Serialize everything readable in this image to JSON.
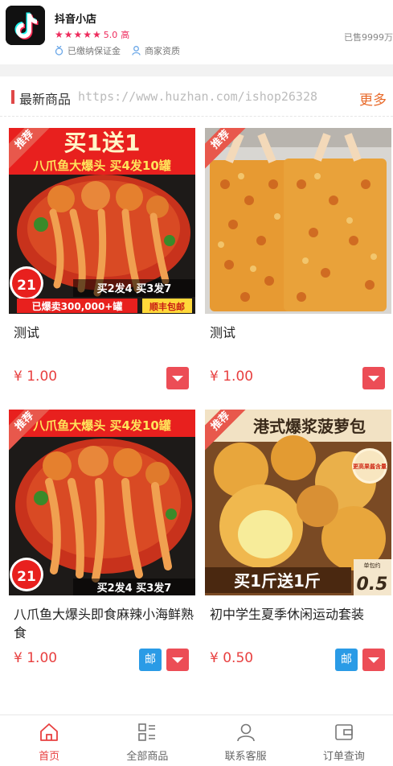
{
  "shop": {
    "name": "抖音小店",
    "stars": "★★★★★",
    "rating": "5.0",
    "rating_label": "高",
    "deposit": "已缴纳保证金",
    "qualification": "商家资质",
    "sold": "已售9999万"
  },
  "section": {
    "title": "最新商品",
    "watermark": "https://www.huzhan.com/ishop26328",
    "more": "更多"
  },
  "products": [
    {
      "tag": "推荐",
      "title": "测试",
      "price": "¥ 1.00",
      "image": "octopus-promo-image",
      "banner_top": "买1送1",
      "banner_mid": "八爪鱼大爆头 买4发10罐",
      "price_badge": "21",
      "promo_line": "买2发4 买3发7",
      "sold_line": "已爆卖300,000+罐",
      "ship": "顺丰包邮",
      "has_mail": false
    },
    {
      "tag": "推荐",
      "title": "测试",
      "price": "¥ 1.00",
      "image": "peanut-bags-image",
      "has_mail": false
    },
    {
      "tag": "推荐",
      "title": "八爪鱼大爆头即食麻辣小海鲜熟食",
      "price": "¥ 1.00",
      "image": "octopus-image",
      "banner_mid": "八爪鱼大爆头 买4发10罐",
      "price_badge": "21",
      "promo_line": "买2发4 买3发7",
      "has_mail": true,
      "mail_label": "邮"
    },
    {
      "tag": "推荐",
      "title": "初中学生夏季休闲运动套装",
      "price": "¥ 0.50",
      "image": "pineapple-bun-image",
      "banner_top": "港式爆浆菠萝包",
      "side_badge": "更高果酱含量",
      "banner_bottom": "买1斤送1斤",
      "unit_price": "0.5",
      "unit_label": "单包约",
      "has_mail": true,
      "mail_label": "邮"
    }
  ],
  "tabs": [
    {
      "label": "首页",
      "icon": "home-icon",
      "active": true
    },
    {
      "label": "全部商品",
      "icon": "category-list-icon",
      "active": false
    },
    {
      "label": "联系客服",
      "icon": "user-icon",
      "active": false
    },
    {
      "label": "订单查询",
      "icon": "wallet-icon",
      "active": false
    }
  ],
  "colors": {
    "accent": "#e84040",
    "star": "#ee2a5c",
    "more": "#e86a2a",
    "cart": "#ec4d56",
    "mail": "#2a9be6"
  }
}
